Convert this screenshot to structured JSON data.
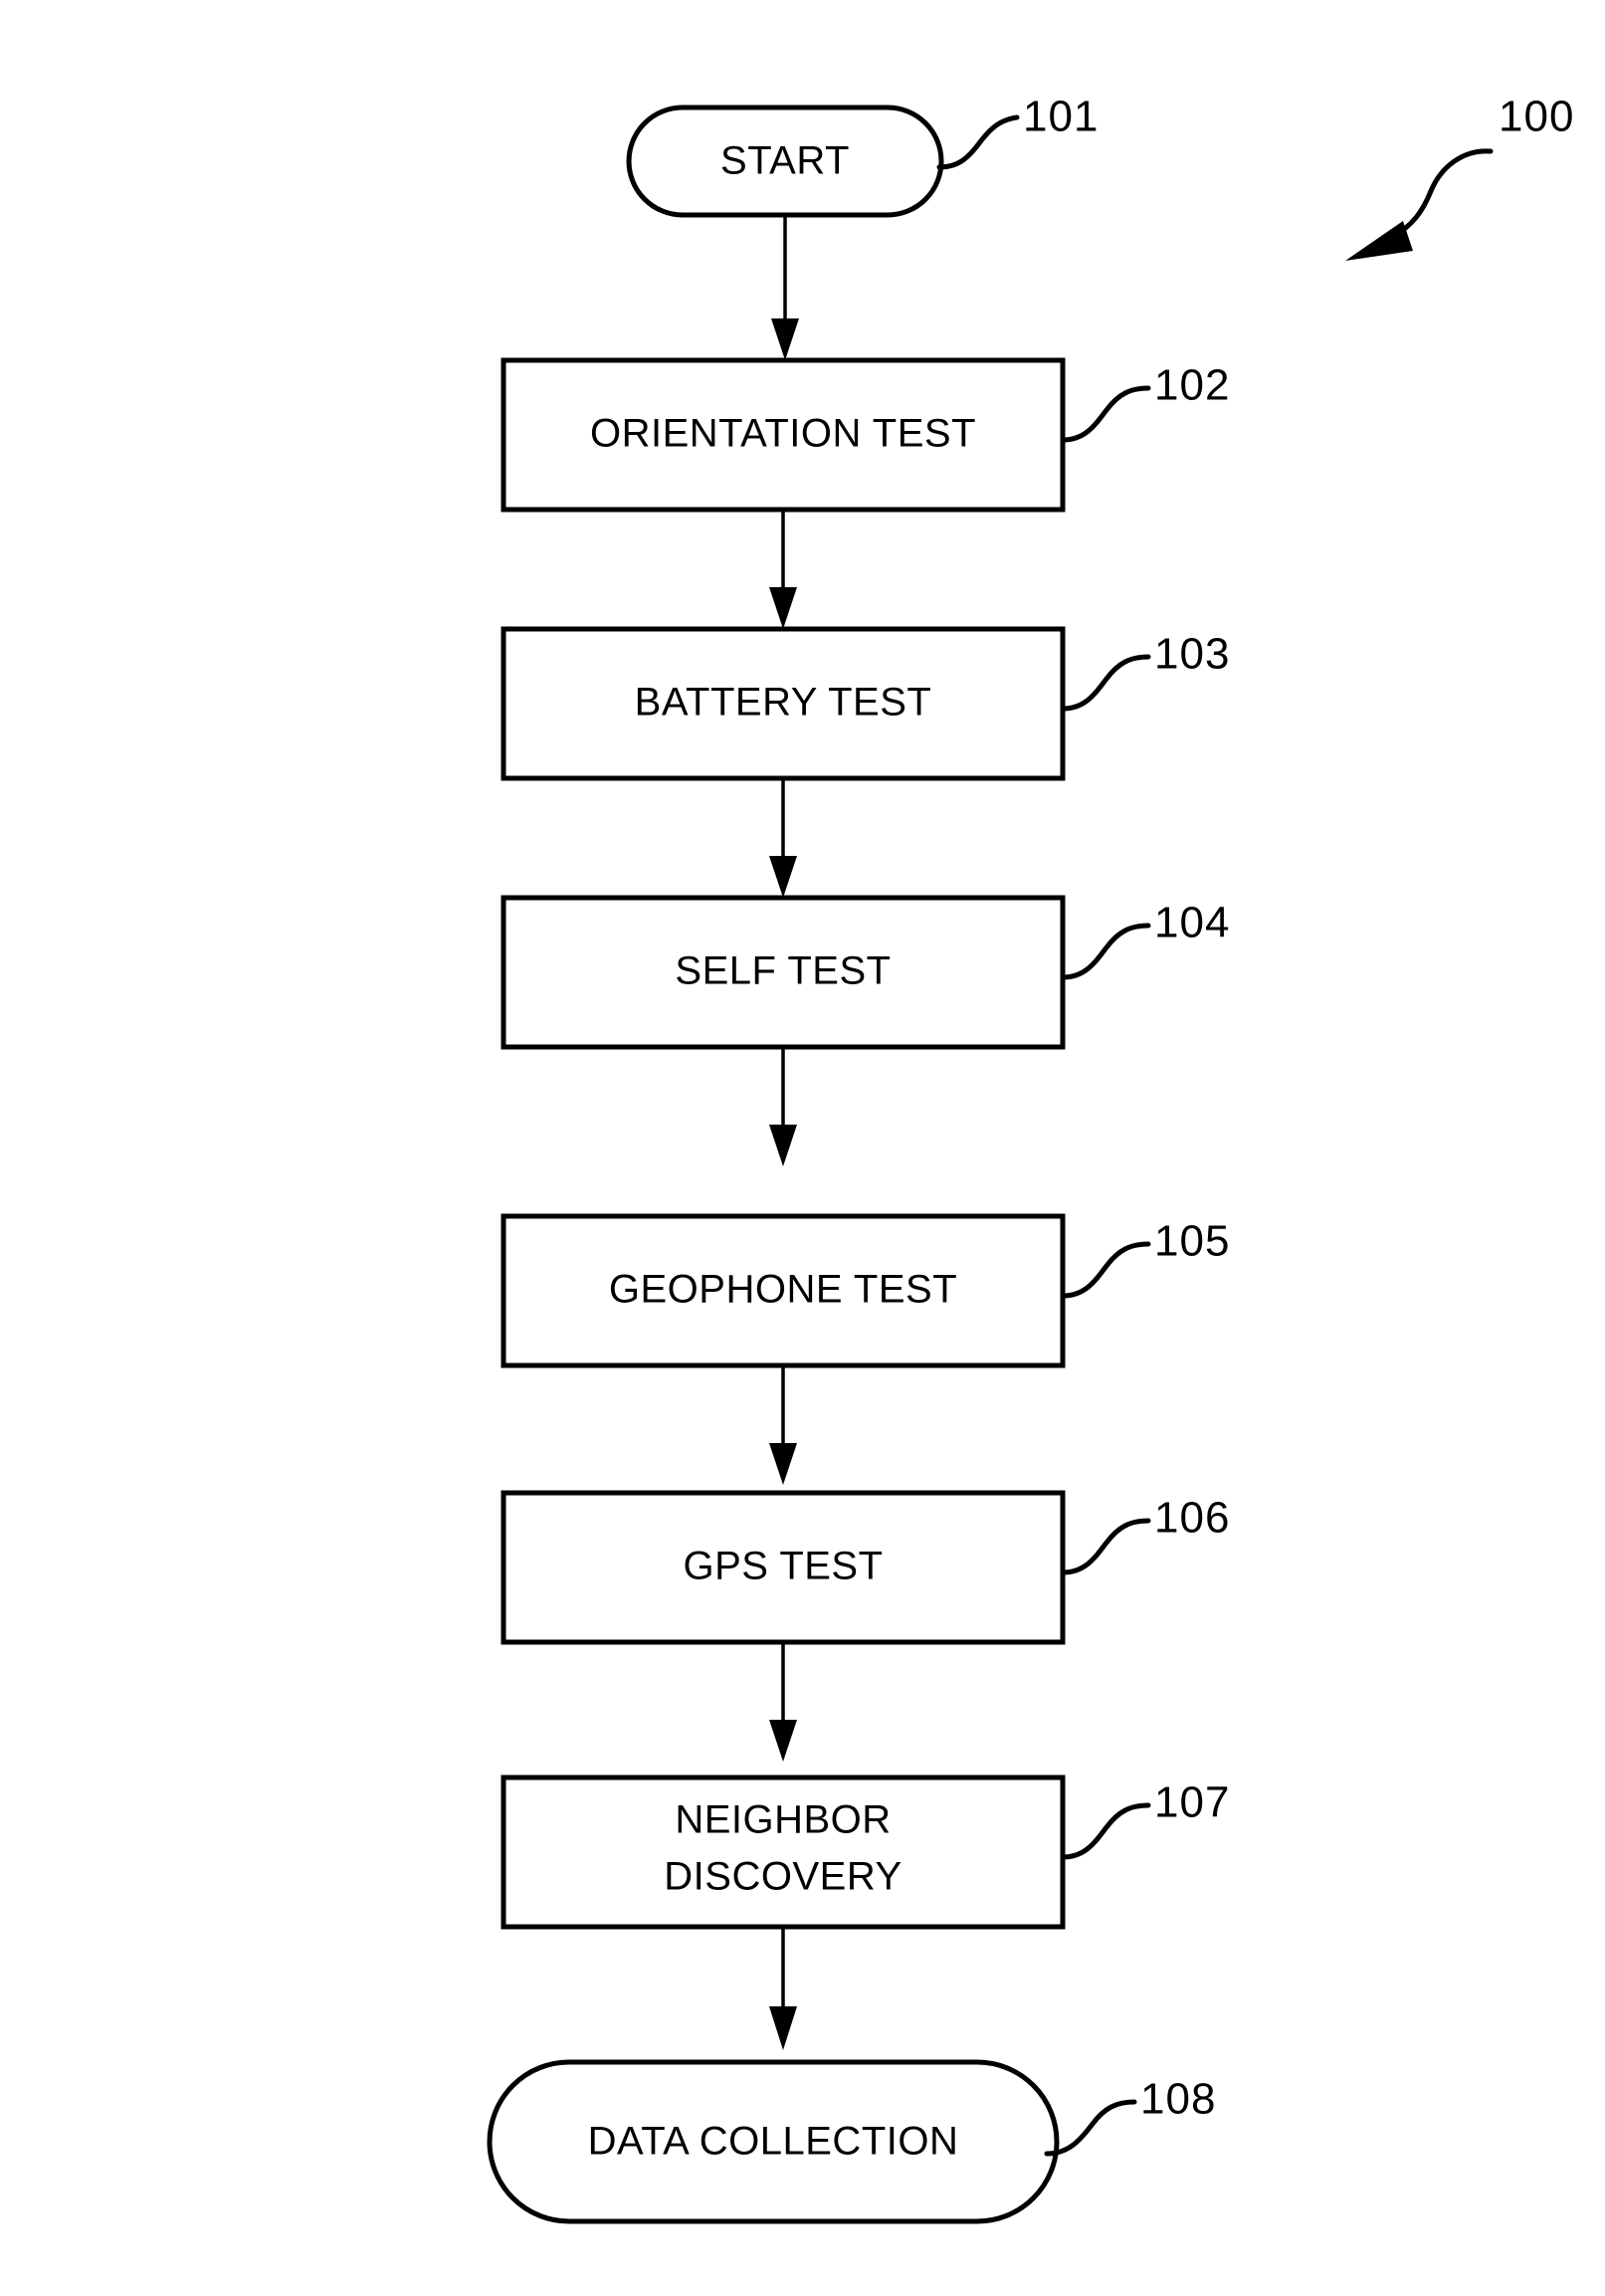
{
  "figure": {
    "type": "flowchart",
    "orientation": "vertical",
    "reference_numeral": "100",
    "reference_numeral_name": "figure-callout"
  },
  "nodes": [
    {
      "id": "start",
      "shape": "terminator",
      "label": "START",
      "label_lines": [
        "START"
      ],
      "ref": "101"
    },
    {
      "id": "orientation_test",
      "shape": "process",
      "label": "ORIENTATION TEST",
      "label_lines": [
        "ORIENTATION TEST"
      ],
      "ref": "102"
    },
    {
      "id": "battery_test",
      "shape": "process",
      "label": "BATTERY TEST",
      "label_lines": [
        "BATTERY TEST"
      ],
      "ref": "103"
    },
    {
      "id": "self_test",
      "shape": "process",
      "label": "SELF TEST",
      "label_lines": [
        "SELF TEST"
      ],
      "ref": "104"
    },
    {
      "id": "geophone_test",
      "shape": "process",
      "label": "GEOPHONE TEST",
      "label_lines": [
        "GEOPHONE TEST"
      ],
      "ref": "105"
    },
    {
      "id": "gps_test",
      "shape": "process",
      "label": "GPS TEST",
      "label_lines": [
        "GPS TEST"
      ],
      "ref": "106"
    },
    {
      "id": "neighbor_discovery",
      "shape": "process",
      "label": "NEIGHBOR DISCOVERY",
      "label_lines": [
        "NEIGHBOR",
        "DISCOVERY"
      ],
      "ref": "107"
    },
    {
      "id": "data_collection",
      "shape": "terminator",
      "label": "DATA COLLECTION",
      "label_lines": [
        "DATA COLLECTION"
      ],
      "ref": "108"
    }
  ],
  "edges": [
    {
      "from": "start",
      "to": "orientation_test"
    },
    {
      "from": "orientation_test",
      "to": "battery_test"
    },
    {
      "from": "battery_test",
      "to": "self_test"
    },
    {
      "from": "self_test",
      "to": "geophone_test"
    },
    {
      "from": "geophone_test",
      "to": "gps_test"
    },
    {
      "from": "gps_test",
      "to": "neighbor_discovery"
    },
    {
      "from": "neighbor_discovery",
      "to": "data_collection"
    }
  ],
  "colors": {
    "stroke": "#000000",
    "fill": "#ffffff",
    "background": "#ffffff"
  }
}
